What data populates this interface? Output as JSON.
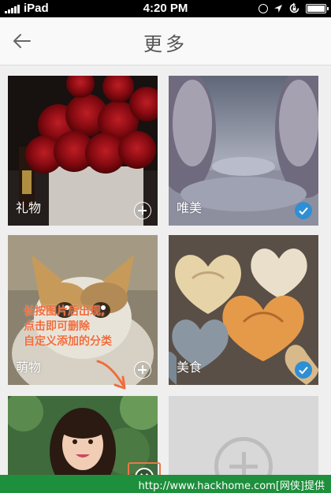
{
  "status_bar": {
    "carrier": "iPad",
    "time": "4:20 PM",
    "icons": [
      "clock-icon",
      "location-arrow-icon",
      "rotation-lock-icon",
      "battery-icon"
    ]
  },
  "header": {
    "back_icon": "arrow-left-icon",
    "title": "更多"
  },
  "tiles": [
    {
      "label": "礼物",
      "image": "red-roses-gift-box",
      "state": "add"
    },
    {
      "label": "唯美",
      "image": "snowy-winter-trees",
      "state": "selected"
    },
    {
      "label": "萌物",
      "image": "kitten",
      "state": "add"
    },
    {
      "label": "美食",
      "image": "heart-shaped-cookies",
      "state": "selected"
    },
    {
      "label": "",
      "image": "girl-portrait",
      "state": "deletable"
    },
    {
      "label": "",
      "image": "",
      "state": "add-new"
    }
  ],
  "annotation": {
    "lines": [
      "长按图片后出现,",
      "点击即可删除",
      "自定义添加的分类"
    ],
    "color": "#f06d3c"
  },
  "colors": {
    "selected_badge": "#2f8fd4",
    "watermark_bar": "#1e8f3c",
    "highlight": "#e8784a"
  },
  "watermark": {
    "text": "http://www.hackhome.com[网侠]提供"
  }
}
